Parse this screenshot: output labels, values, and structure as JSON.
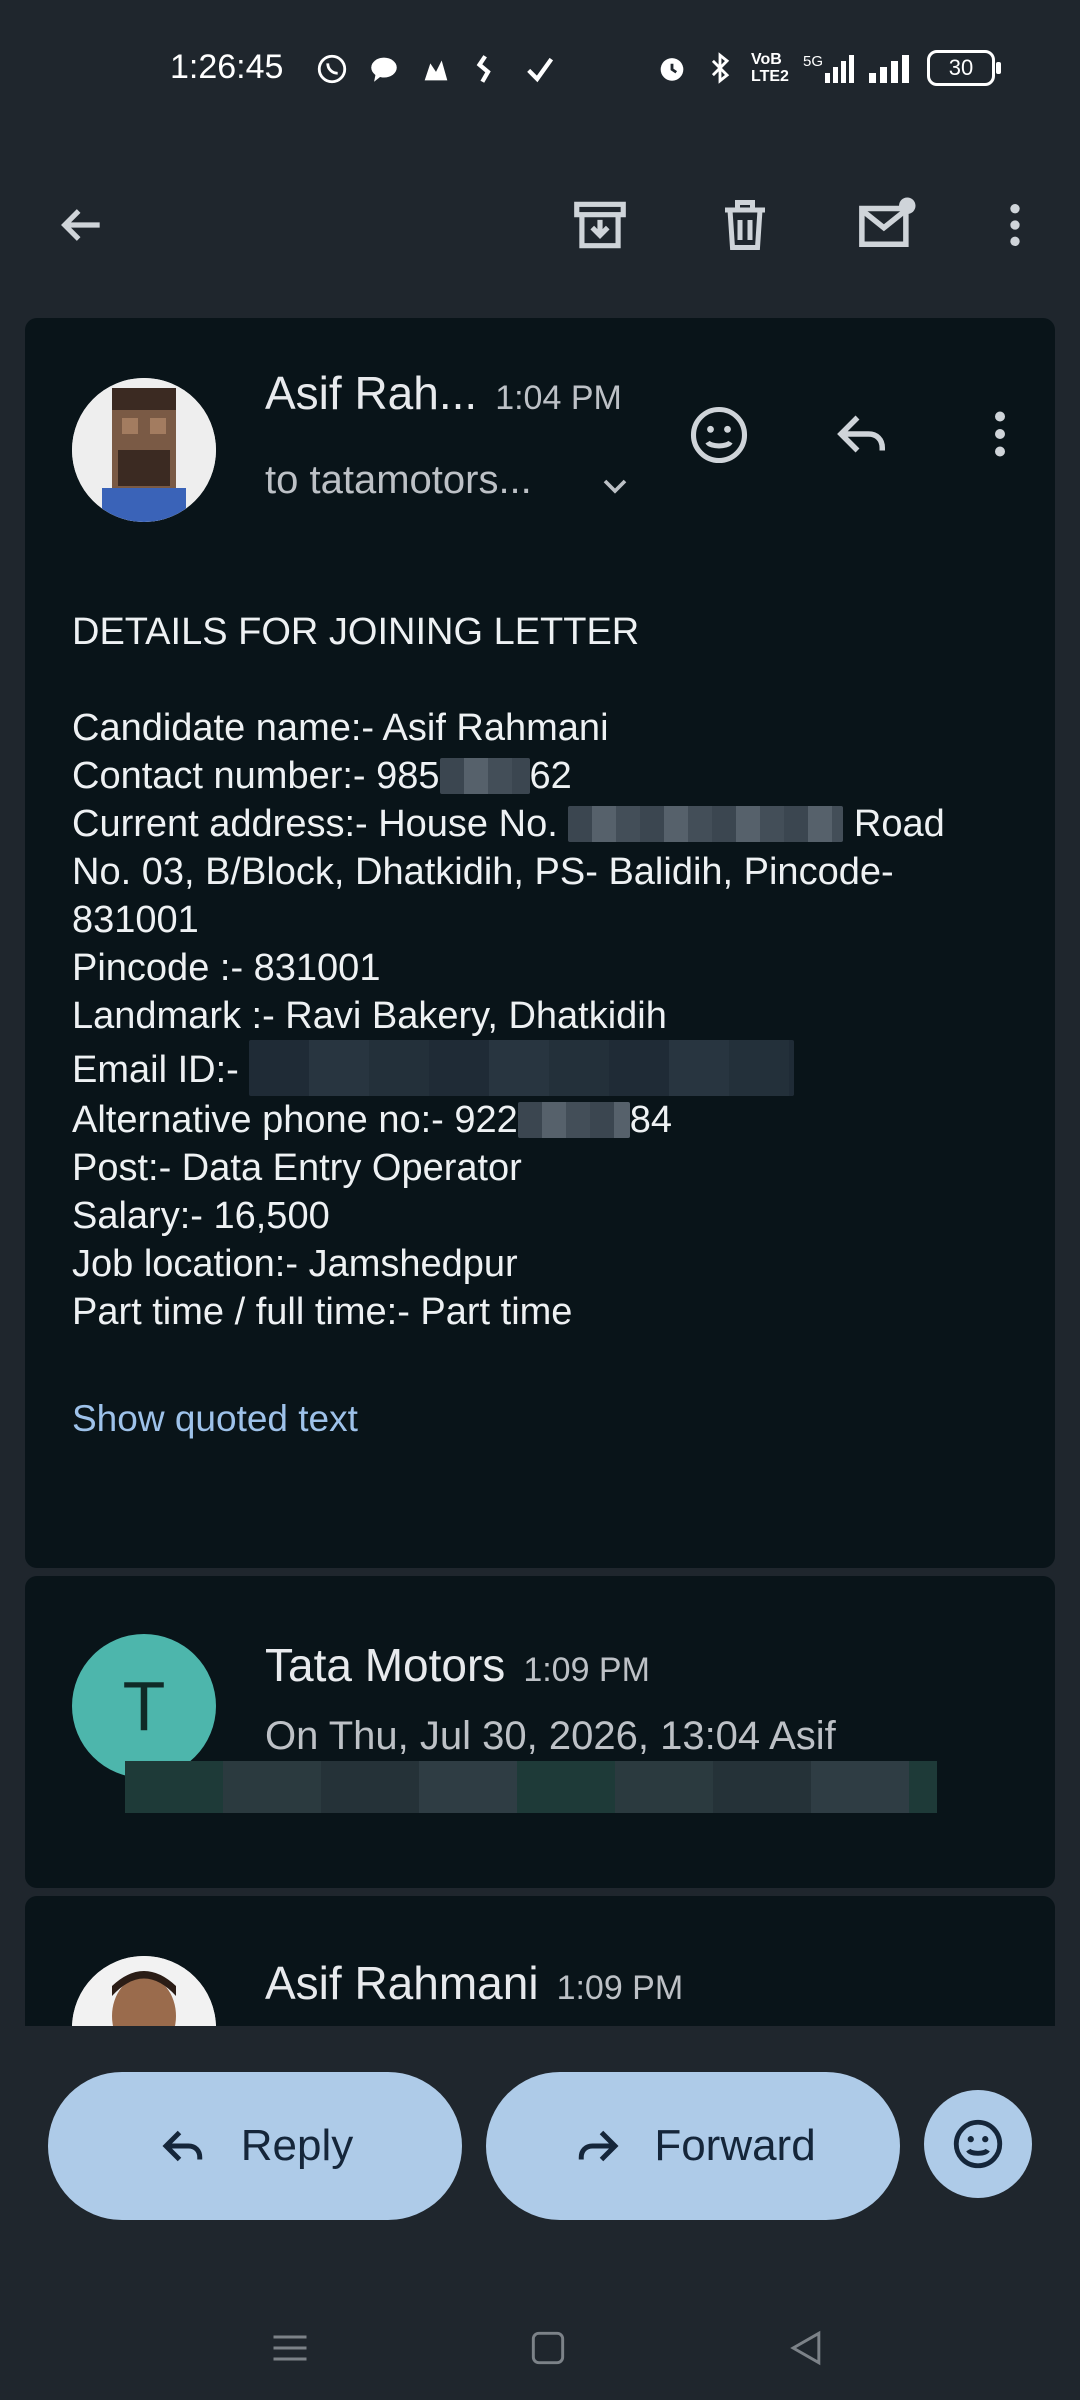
{
  "status_bar": {
    "time": "1:26:45",
    "net_label": "VoB LTE2",
    "five_g": "5G",
    "battery": "30"
  },
  "toolbar": {
    "icons": [
      "back-arrow-icon",
      "archive-icon",
      "trash-icon",
      "mark-unread-icon",
      "more-vert-icon"
    ]
  },
  "email1": {
    "sender": "Asif Rah...",
    "time": "1:04 PM",
    "recipient": "to tatamotors...",
    "lines": {
      "subject": "DETAILS FOR JOINING LETTER",
      "candidate": "Candidate name:- Asif Rahmani",
      "contact_prefix": "Contact number:- 985",
      "contact_suffix": "62",
      "address_prefix": "Current address:- House No.",
      "address_suffix": "Road",
      "address_line2": "No. 03, B/Block, Dhatkidih, PS- Balidih, Pincode-",
      "address_line3": "831001",
      "pincode": "Pincode :- 831001",
      "landmark": "Landmark :- Ravi Bakery, Dhatkidih",
      "email_prefix": "Email ID:-",
      "alt_prefix": "Alternative phone no:- 922",
      "alt_suffix": "84",
      "post": "Post:- Data Entry Operator",
      "salary": "Salary:- 16,500",
      "location": "Job location:- Jamshedpur",
      "parttime": "Part time / full time:- Part time"
    },
    "show_quoted": "Show quoted text"
  },
  "email2": {
    "avatar_letter": "T",
    "sender": "Tata Motors",
    "time": "1:09 PM",
    "snippet": "On Thu, Jul 30, 2026, 13:04 Asif"
  },
  "email3": {
    "sender": "Asif Rahmani",
    "time": "1:09 PM"
  },
  "actions": {
    "reply": "Reply",
    "forward": "Forward"
  },
  "colors": {
    "background": "#1f262d",
    "card": "#091419",
    "pill": "#aecbe8",
    "link": "#9ec2ea",
    "avatar_t": "#4db6ac"
  }
}
